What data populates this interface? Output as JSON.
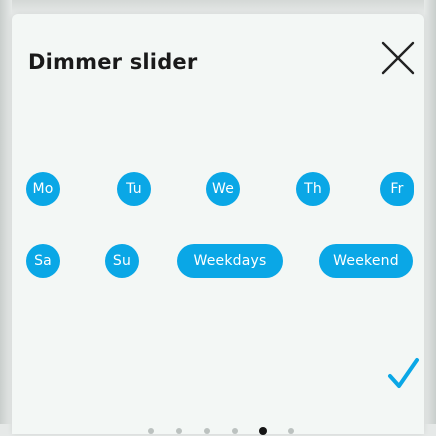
{
  "dialog": {
    "title": "Dimmer slider",
    "close_icon": "close-icon",
    "confirm_icon": "checkmark-icon"
  },
  "days": [
    {
      "label": "Mo"
    },
    {
      "label": "Tu"
    },
    {
      "label": "We"
    },
    {
      "label": "Th"
    },
    {
      "label": "Fr"
    },
    {
      "label": "Sa"
    },
    {
      "label": "Su"
    },
    {
      "label": "Weekdays"
    },
    {
      "label": "Weekend"
    }
  ],
  "pagination": {
    "total": 6,
    "current": 5
  },
  "colors": {
    "accent": "#0aa7e6",
    "panel_background": "#f3f7f5",
    "title_text": "#1a1a1a"
  }
}
